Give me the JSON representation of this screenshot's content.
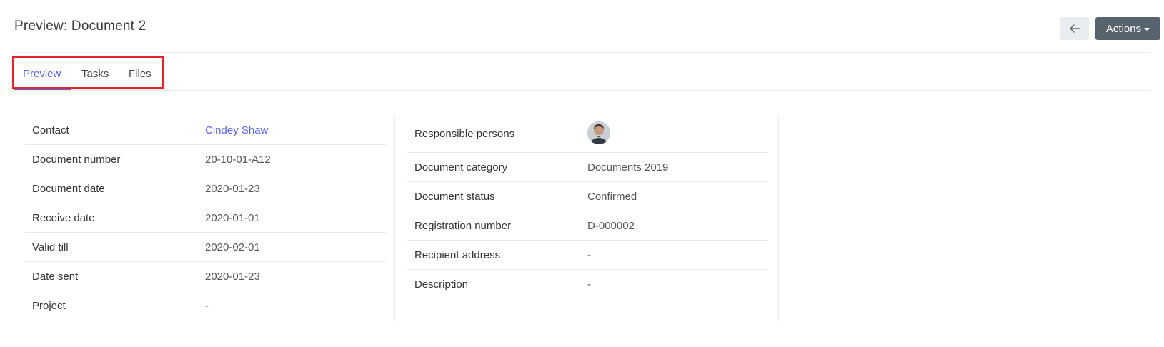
{
  "header": {
    "title": "Preview: Document 2",
    "actions_label": "Actions"
  },
  "tabs": [
    {
      "label": "Preview",
      "active": true
    },
    {
      "label": "Tasks",
      "active": false
    },
    {
      "label": "Files",
      "active": false
    }
  ],
  "left_details": [
    {
      "label": "Contact",
      "value": "Cindey Shaw"
    },
    {
      "label": "Document number",
      "value": "20-10-01-A12"
    },
    {
      "label": "Document date",
      "value": "2020-01-23"
    },
    {
      "label": "Receive date",
      "value": "2020-01-01"
    },
    {
      "label": "Valid till",
      "value": "2020-02-01"
    },
    {
      "label": "Date sent",
      "value": "2020-01-23"
    },
    {
      "label": "Project",
      "value": "-"
    }
  ],
  "right_details": [
    {
      "label": "Responsible persons",
      "value": "avatar"
    },
    {
      "label": "Document category",
      "value": "Documents 2019"
    },
    {
      "label": "Document status",
      "value": "Confirmed"
    },
    {
      "label": "Registration number",
      "value": "D-000002"
    },
    {
      "label": "Recipient address",
      "value": "-"
    },
    {
      "label": "Description",
      "value": "-"
    }
  ],
  "colors": {
    "accent": "#5b63e6",
    "actions_bg": "#56636d",
    "highlight_box": "#e0242b"
  },
  "icons": {
    "back": "arrow-left-icon",
    "actions_caret": "caret-down-icon"
  }
}
